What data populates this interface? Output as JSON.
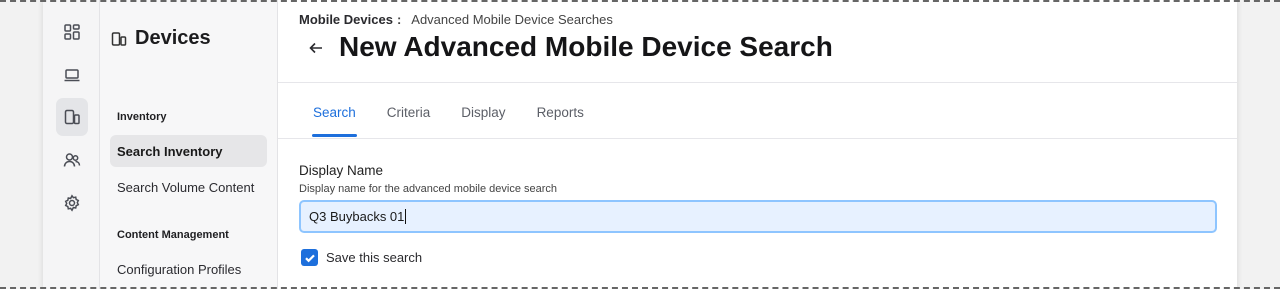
{
  "rail": {
    "icons": [
      "dashboard-icon",
      "computer-icon",
      "mobile-devices-icon",
      "users-icon",
      "settings-icon"
    ],
    "active": "mobile-devices-icon"
  },
  "sidebar": {
    "title": "Devices",
    "sections": [
      {
        "heading": "Inventory",
        "items": [
          "Search Inventory",
          "Search Volume Content"
        ]
      },
      {
        "heading": "Content Management",
        "items": [
          "Configuration Profiles"
        ]
      }
    ],
    "active_item": "Search Inventory"
  },
  "header": {
    "breadcrumb_root": "Mobile Devices",
    "breadcrumb_sep": ":",
    "breadcrumb_current": "Advanced Mobile Device Searches",
    "title": "New Advanced Mobile Device Search"
  },
  "tabs": [
    {
      "label": "Search",
      "active": true
    },
    {
      "label": "Criteria",
      "active": false
    },
    {
      "label": "Display",
      "active": false
    },
    {
      "label": "Reports",
      "active": false
    }
  ],
  "form": {
    "display_name_label": "Display Name",
    "display_name_help": "Display name for the advanced mobile device search",
    "display_name_value": "Q3 Buybacks 01",
    "save_search_label": "Save this search",
    "save_search_checked": true
  },
  "colors": {
    "accent": "#1d6fdc",
    "input_focus_bg": "#e7f1ff",
    "input_focus_border": "#8ec5ff"
  }
}
